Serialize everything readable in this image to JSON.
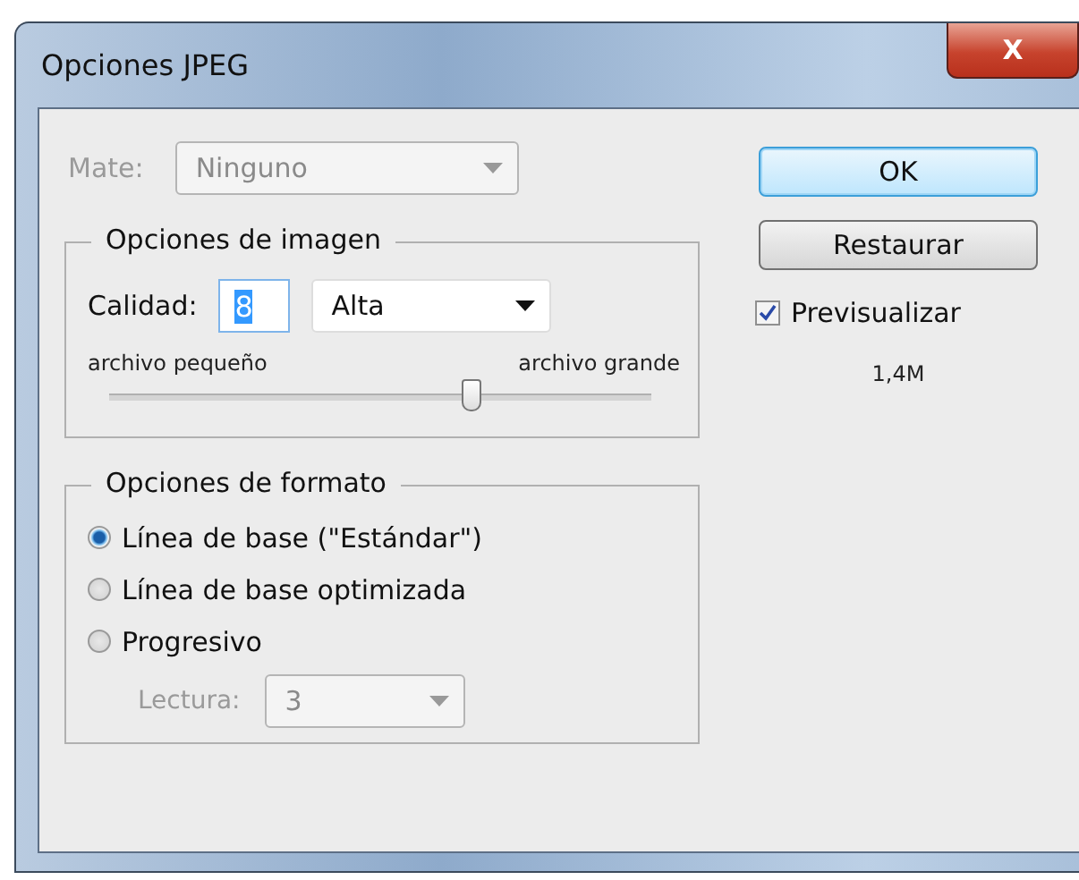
{
  "window": {
    "title": "Opciones JPEG",
    "close_label": "X"
  },
  "matte": {
    "label": "Mate:",
    "value": "Ninguno",
    "disabled": true
  },
  "image_options": {
    "title": "Opciones de imagen",
    "quality_label": "Calidad:",
    "quality_value": "8",
    "quality_preset": "Alta",
    "small_label": "archivo pequeño",
    "large_label": "archivo grande",
    "level": 0.67
  },
  "format_options": {
    "title": "Opciones de formato",
    "options": [
      {
        "label": "Línea de base (\"Estándar\")",
        "selected": true
      },
      {
        "label": "Línea de base optimizada",
        "selected": false
      },
      {
        "label": "Progresivo",
        "selected": false
      }
    ],
    "scans": {
      "label": "Lectura:",
      "value": "3",
      "disabled": true
    }
  },
  "buttons": [
    {
      "label": "OK",
      "default": true
    },
    {
      "label": "Restaurar",
      "default": false
    }
  ],
  "preview": {
    "label": "Previsualizar",
    "checked": true
  },
  "file_size": "1,4M"
}
